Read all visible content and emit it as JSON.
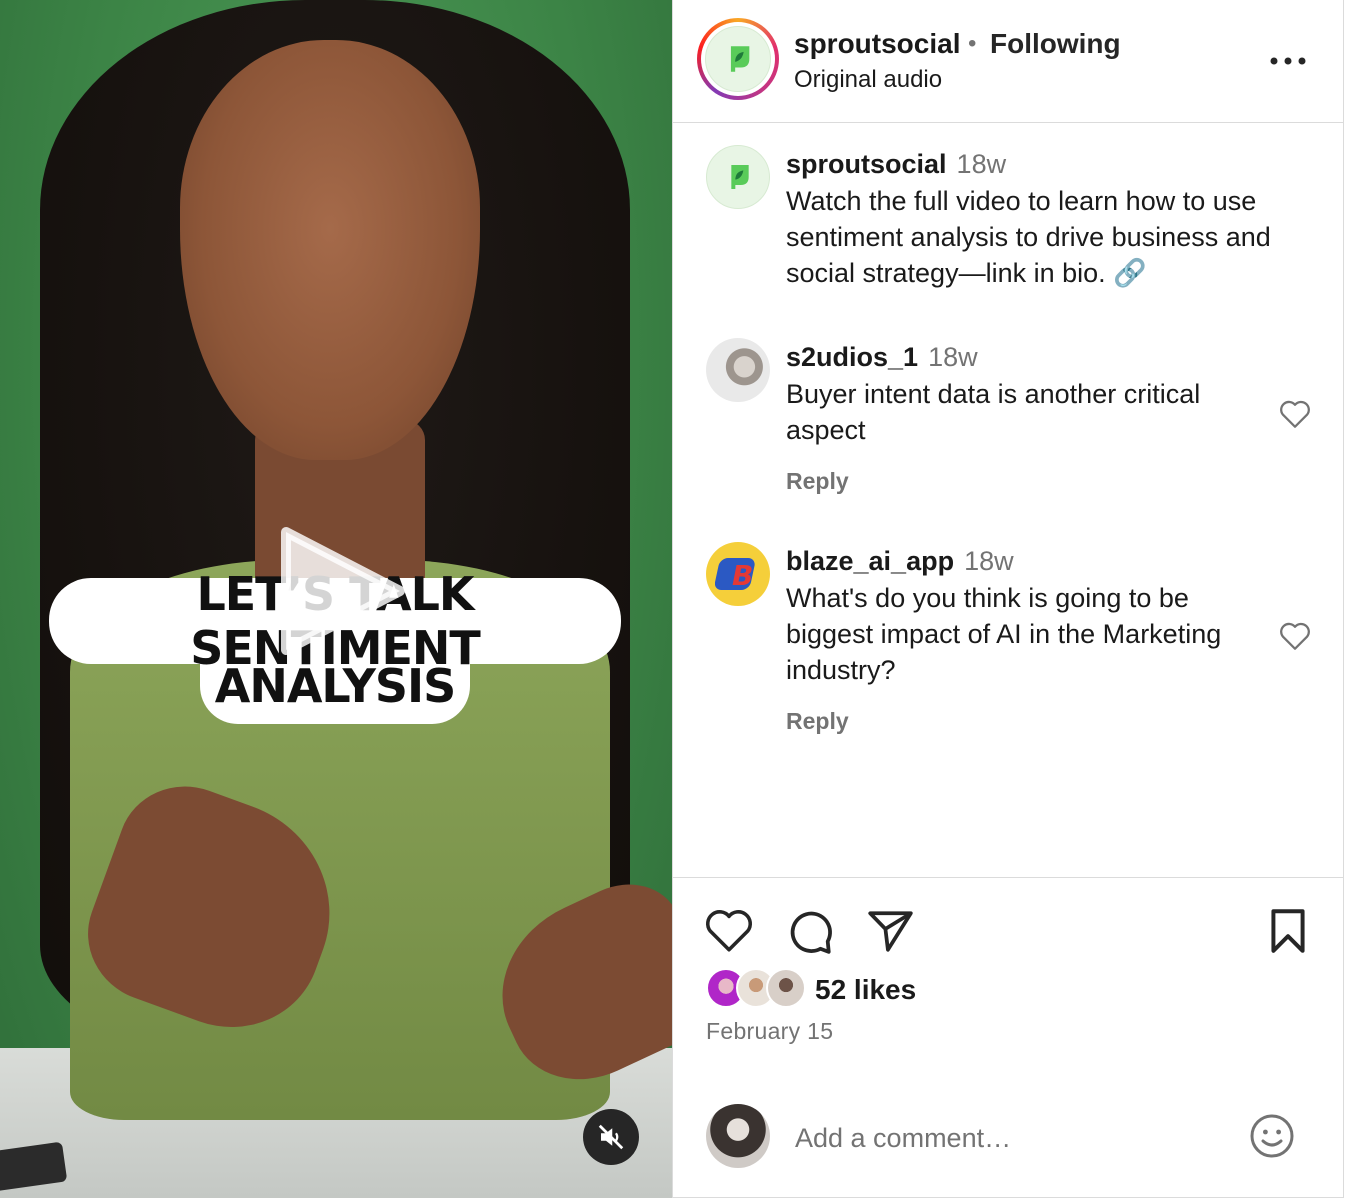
{
  "media": {
    "caption_line1": "LET’S TALK SENTIMENT",
    "caption_line2": "ANALYSIS",
    "play_icon": "play-icon",
    "mute_icon": "speaker-muted-icon"
  },
  "header": {
    "username": "sproutsocial",
    "separator": "•",
    "follow_label": "Following",
    "audio_label": "Original audio",
    "more_icon": "more-horizontal-icon"
  },
  "caption": {
    "username": "sproutsocial",
    "time": "18w",
    "text": "Watch the full video to learn how to use sentiment analysis to drive business and social strategy—link in bio. 🔗"
  },
  "comments": [
    {
      "username": "s2udios_1",
      "time": "18w",
      "text": "Buyer intent data is another critical aspect",
      "reply_label": "Reply"
    },
    {
      "username": "blaze_ai_app",
      "time": "18w",
      "text": "What's do you think is going to be biggest impact of AI in the Marketing industry?",
      "reply_label": "Reply"
    }
  ],
  "actions": {
    "like_icon": "heart-icon",
    "comment_icon": "comment-bubble-icon",
    "share_icon": "paper-plane-icon",
    "save_icon": "bookmark-icon"
  },
  "likes_label": "52 likes",
  "date_label": "February 15",
  "add_comment": {
    "placeholder": "Add a comment…",
    "emoji_icon": "smiley-icon"
  },
  "colors": {
    "brand_green": "#59cb59",
    "muted_text": "#737373",
    "divider": "#dbdbdb"
  }
}
